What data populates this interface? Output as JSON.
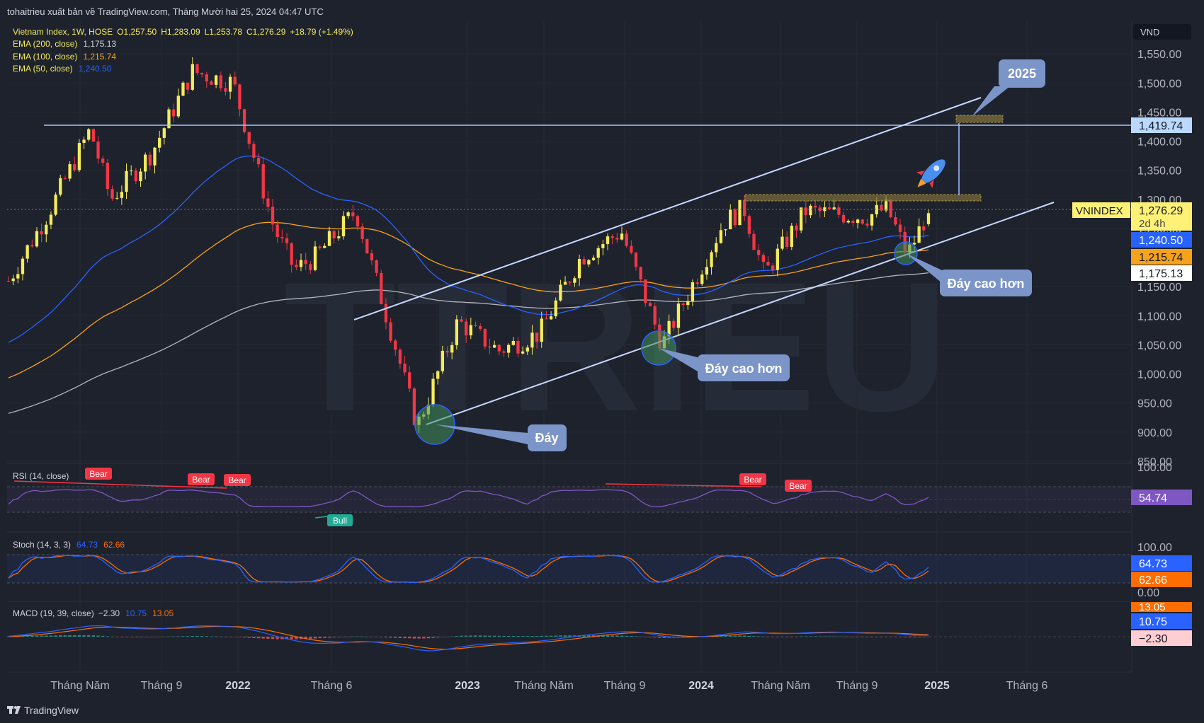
{
  "header": {
    "publish_line": "tohaitrieu xuất bản về TradingView.com, Tháng Mười hai 25, 2024 04:47 UTC",
    "footer_brand": "TradingView",
    "currency": "VND"
  },
  "legend": {
    "symbol": "Vietnam Index, 1W, HOSE",
    "open": "O1,257.50",
    "high": "H1,283.09",
    "low": "L1,253.78",
    "close": "C1,276.29",
    "change": "+18.79 (+1.49%)",
    "ema200_label": "EMA (200, close)",
    "ema200_value": "1,175.13",
    "ema100_label": "EMA (100, close)",
    "ema100_value": "1,215.74",
    "ema50_label": "EMA (50, close)",
    "ema50_value": "1,240.50"
  },
  "colors": {
    "background": "#1e222d",
    "up": "#f5ec5b",
    "down": "#f23645",
    "ema50": "#2962ff",
    "ema100": "#f7a21b",
    "ema200": "#b2b5be",
    "trendline": "#a7c3ff",
    "rsi": "#7e57c2",
    "stoch_k": "#2962ff",
    "stoch_d": "#ff6d00"
  },
  "price_axis": {
    "ticks": [
      "1,550.00",
      "1,500.00",
      "1,450.00",
      "1,400.00",
      "1,350.00",
      "1,300.00",
      "1,250.00",
      "1,150.00",
      "1,100.00",
      "1,050.00",
      "1,000.00",
      "950.00",
      "900.00",
      "850.00"
    ],
    "tags": {
      "resistance": "1,419.74",
      "symbol": "VNINDEX",
      "last": "1,276.29",
      "countdown": "2d 4h",
      "ema50": "1,240.50",
      "ema100": "1,215.74",
      "ema200": "1,175.13"
    }
  },
  "time_axis": [
    "Tháng Năm",
    "Tháng 9",
    "2022",
    "Tháng 6",
    "2023",
    "Tháng Năm",
    "Tháng 9",
    "2024",
    "Tháng Năm",
    "Tháng 9",
    "2025",
    "Tháng 6"
  ],
  "annotations": {
    "target": "2025",
    "bottom": "Đáy",
    "higher_low_1": "Đáy cao hơn",
    "higher_low_2": "Đáy cao hơn",
    "rocket_icon": "rocket-icon"
  },
  "rsi": {
    "label": "RSI (14, close)",
    "value_tag": "54.74",
    "axis_top": "100.00",
    "signals": [
      "Bear",
      "Bear",
      "Bear",
      "Bull",
      "Bear",
      "Bear"
    ]
  },
  "stoch": {
    "label": "Stoch (14, 3, 3)",
    "k": "64.73",
    "d": "62.66",
    "axis_top": "100.00",
    "axis_bottom": "0.00"
  },
  "macd": {
    "label": "MACD (19, 39, close)",
    "hist": "−2.30",
    "macd": "10.75",
    "signal": "13.05"
  },
  "chart_data": {
    "type": "candlestick",
    "title": "Vietnam Index, 1W, HOSE",
    "ylim": [
      850,
      1560
    ],
    "resistance_level": 1419.74,
    "series": [
      {
        "name": "VNINDEX",
        "anchors": [
          {
            "x": "2021-03",
            "y": 1160
          },
          {
            "x": "2021-05",
            "y": 1280
          },
          {
            "x": "2021-07",
            "y": 1420
          },
          {
            "x": "2021-08",
            "y": 1300
          },
          {
            "x": "2021-10",
            "y": 1380
          },
          {
            "x": "2021-12",
            "y": 1520
          },
          {
            "x": "2022-02",
            "y": 1500
          },
          {
            "x": "2022-04",
            "y": 1250
          },
          {
            "x": "2022-05",
            "y": 1180
          },
          {
            "x": "2022-06",
            "y": 1200
          },
          {
            "x": "2022-08",
            "y": 1280
          },
          {
            "x": "2022-10",
            "y": 1040
          },
          {
            "x": "2022-11",
            "y": 910
          },
          {
            "x": "2023-01",
            "y": 1090
          },
          {
            "x": "2023-03",
            "y": 1040
          },
          {
            "x": "2023-05",
            "y": 1070
          },
          {
            "x": "2023-07",
            "y": 1200
          },
          {
            "x": "2023-09",
            "y": 1245
          },
          {
            "x": "2023-11",
            "y": 1050
          },
          {
            "x": "2023-12",
            "y": 1120
          },
          {
            "x": "2024-02",
            "y": 1260
          },
          {
            "x": "2024-03",
            "y": 1285
          },
          {
            "x": "2024-04",
            "y": 1170
          },
          {
            "x": "2024-06",
            "y": 1280
          },
          {
            "x": "2024-09",
            "y": 1270
          },
          {
            "x": "2024-10",
            "y": 1285
          },
          {
            "x": "2024-11",
            "y": 1205
          },
          {
            "x": "2024-12",
            "y": 1276.29
          }
        ]
      },
      {
        "name": "EMA (50, close)",
        "last": 1240.5
      },
      {
        "name": "EMA (100, close)",
        "last": 1215.74
      },
      {
        "name": "EMA (200, close)",
        "last": 1175.13
      }
    ]
  }
}
